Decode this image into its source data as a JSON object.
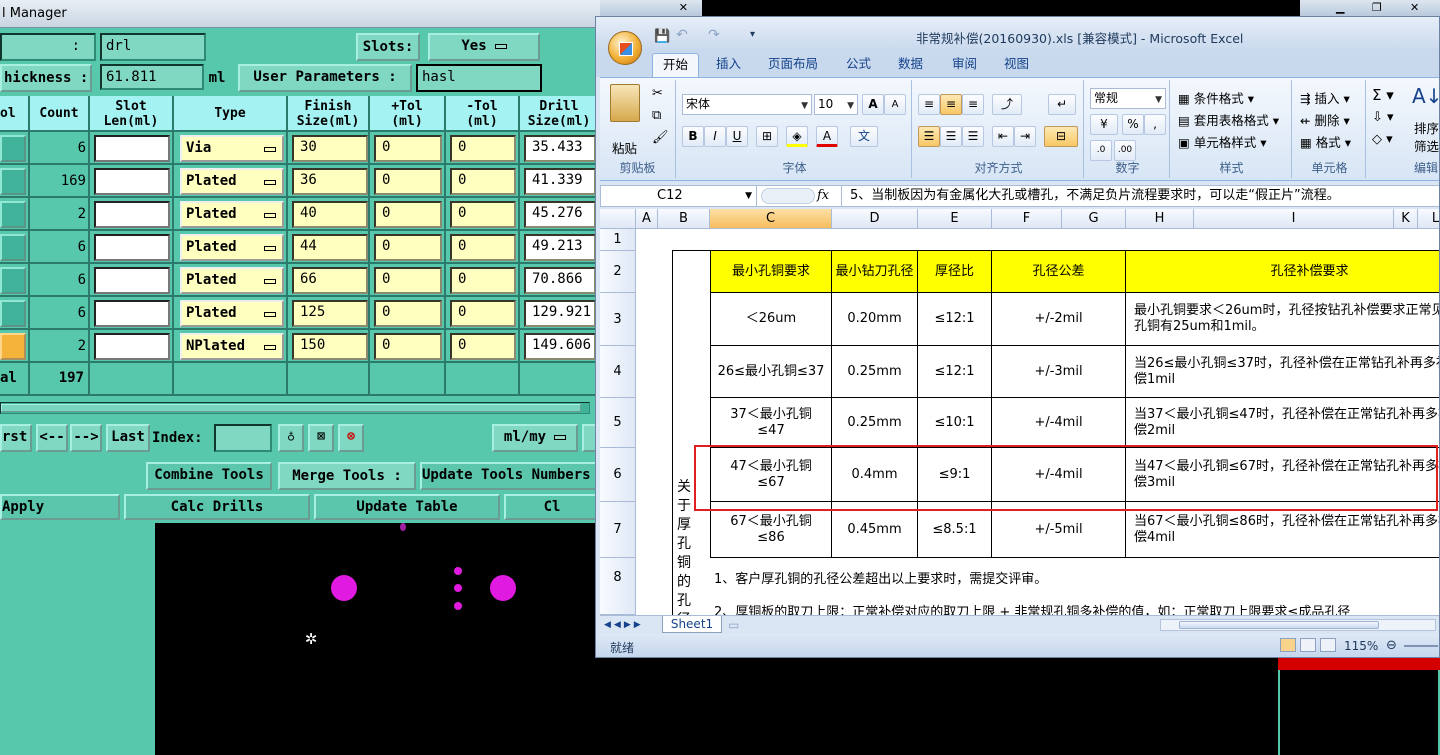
{
  "tool_manager": {
    "title": "l Manager",
    "top_left_label": ":",
    "name_value": "drl",
    "slots_label": "Slots:",
    "slots_value": "Yes",
    "thickness_label": "hickness :",
    "thickness_value": "61.811",
    "thickness_unit": "ml",
    "user_params_button": "User Parameters :",
    "user_params_value": "hasl",
    "columns": [
      "ol",
      "Count",
      "Slot\nLen(ml)",
      "Type",
      "Finish\nSize(ml)",
      "+Tol\n(ml)",
      "-Tol\n(ml)",
      "Drill\nSize(ml)"
    ],
    "rows": [
      {
        "count": "6",
        "type": "Via",
        "finish": "30",
        "ptol": "0",
        "ntol": "0",
        "drill": "35.433"
      },
      {
        "count": "169",
        "type": "Plated",
        "finish": "36",
        "ptol": "0",
        "ntol": "0",
        "drill": "41.339"
      },
      {
        "count": "2",
        "type": "Plated",
        "finish": "40",
        "ptol": "0",
        "ntol": "0",
        "drill": "45.276"
      },
      {
        "count": "6",
        "type": "Plated",
        "finish": "44",
        "ptol": "0",
        "ntol": "0",
        "drill": "49.213"
      },
      {
        "count": "6",
        "type": "Plated",
        "finish": "66",
        "ptol": "0",
        "ntol": "0",
        "drill": "70.866"
      },
      {
        "count": "6",
        "type": "Plated",
        "finish": "125",
        "ptol": "0",
        "ntol": "0",
        "drill": "129.921"
      },
      {
        "count": "2",
        "type": "NPlated",
        "finish": "150",
        "ptol": "0",
        "ntol": "0",
        "drill": "149.606"
      }
    ],
    "total_label": "al",
    "total_count": "197",
    "nav": {
      "first": "rst",
      "prev": "<--",
      "next": "-->",
      "last": "Last",
      "index_label": "Index:",
      "units": "ml/my"
    },
    "combine_tools": "Combine Tools",
    "merge_tools": "Merge Tools :",
    "update_tools": "Update Tools Numbers",
    "apply": "Apply",
    "calc_drills": "Calc Drills",
    "update_table": "Update Table",
    "close": "Cl"
  },
  "excel": {
    "title": "非常规补偿(20160930).xls  [兼容模式] - Microsoft Excel",
    "tabs": [
      "开始",
      "插入",
      "页面布局",
      "公式",
      "数据",
      "审阅",
      "视图"
    ],
    "clipboard": {
      "paste": "粘贴",
      "group": "剪贴板"
    },
    "font": {
      "name": "宋体",
      "size": "10",
      "group": "字体"
    },
    "alignment": {
      "group": "对齐方式"
    },
    "number": {
      "format": "常规",
      "group": "数字"
    },
    "styles": {
      "conditional": "条件格式",
      "table": "套用表格格式",
      "cell": "单元格样式",
      "group": "样式"
    },
    "cells": {
      "insert": "插入",
      "delete": "删除",
      "format": "格式",
      "group": "单元格"
    },
    "editing": {
      "sort": "排序和",
      "filter": "筛选",
      "group": "编辑"
    },
    "name_box": "C12",
    "fx": "fx",
    "formula": "5、当制板因为有金属化大孔或槽孔，不满足负片流程要求时，可以走“假正片”流程。",
    "col_headers": [
      "A",
      "B",
      "C",
      "D",
      "E",
      "F",
      "G",
      "H",
      "I",
      "K",
      "L"
    ],
    "row_numbers": [
      "1",
      "2",
      "3",
      "4",
      "5",
      "6",
      "7",
      "8"
    ],
    "table_headers": [
      "最小孔铜要求",
      "最小钻刀孔径",
      "厚径比",
      "孔径公差",
      "孔径补偿要求"
    ],
    "table_rows": [
      [
        "＜26um",
        "0.20mm",
        "≤12:1",
        "+/-2mil",
        "最小孔铜要求＜26um时，孔径按钻孔补偿要求正常见孔铜有25um和1mil。"
      ],
      [
        "26≤最小孔铜≤37",
        "0.25mm",
        "≤12:1",
        "+/-3mil",
        "当26≤最小孔铜≤37时，孔径补偿在正常钻孔补再多补偿1mil"
      ],
      [
        "37＜最小孔铜≤47",
        "0.25mm",
        "≤10:1",
        "+/-4mil",
        "当37＜最小孔铜≤47时，孔径补偿在正常钻孔补再多补偿2mil"
      ],
      [
        "47＜最小孔铜≤67",
        "0.4mm",
        "≤9:1",
        "+/-4mil",
        "当47＜最小孔铜≤67时，孔径补偿在正常钻孔补再多补偿3mil"
      ],
      [
        "67＜最小孔铜≤86",
        "0.45mm",
        "≤8.5:1",
        "+/-5mil",
        "当67＜最小孔铜≤86时，孔径补偿在正常钻孔补再多补偿4mil"
      ]
    ],
    "side_label": "关于厚孔铜的孔径",
    "note1": "1、客户厚孔铜的孔径公差超出以上要求时，需提交评审。",
    "note2": "2、厚铜板的取刀上限：正常补偿对应的取刀上限 + 非常规孔铜多补偿的值，如：正常取刀上限要求≤成品孔径",
    "sheet_tab": "Sheet1",
    "status": "就绪",
    "zoom": "115%"
  }
}
